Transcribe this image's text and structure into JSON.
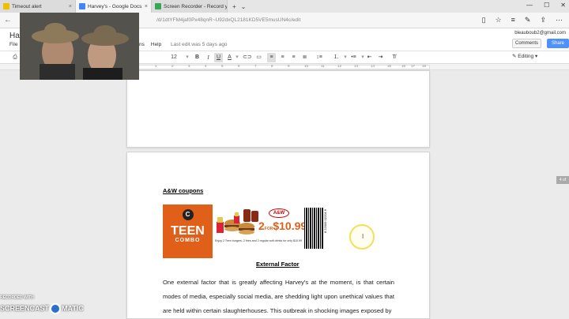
{
  "tabs": [
    {
      "label": "Timeout alert",
      "color": "#f0c000"
    },
    {
      "label": "Harvey's - Google Docs",
      "color": "#4285f4"
    },
    {
      "label": "Screen Recorder - Record y",
      "color": "#34a853"
    }
  ],
  "address": {
    "url": "/d/1dtYFM4jaf0Px48qnR~U92dxQL2181KD5VE5musUN4c/edit"
  },
  "doc": {
    "title": "Har",
    "file_menu": "File",
    "menus": [
      "ns",
      "Help"
    ],
    "last_edit": "Last edit was 5 days ago",
    "user": "bleauboub2@gmail.com",
    "comments": "Comments",
    "share": "Share"
  },
  "toolbar": {
    "font_size": "12",
    "bold": "B",
    "italic": "I",
    "underline": "U",
    "text_color": "A",
    "editing": "Editing"
  },
  "ruler": {
    "ticks": [
      "1",
      "2",
      "3",
      "4",
      "5",
      "6",
      "7",
      "8",
      "9",
      "10",
      "11",
      "12",
      "13",
      "14",
      "15",
      "16",
      "17",
      "18"
    ]
  },
  "page2": {
    "heading": "A&W coupons",
    "coupon": {
      "teen": "TEEN",
      "combo": "COMBO",
      "logo": "A&W",
      "two": "2",
      "for": "FOR",
      "price": "$10.99",
      "fine": "Enjoy 2 Teen burgers, 2 fries and 2 regular soft drinks for only $10.99",
      "barcode_num": "8 22009 02204 6"
    },
    "subheading": "External Factor",
    "paragraph": "One external factor that is greatly affecting Harvey's at the moment, is that certain modes of media, especially social media, are shedding light upon unethical values that are held within certain slaughterhouses. This outbreak in shocking images exposed by"
  },
  "scroll_indicator": "4 of",
  "cursor_icon": "I",
  "watermark": {
    "recorded": "RECORDED WITH",
    "brand_left": "SCREENCAST",
    "brand_right": "MATIC"
  }
}
